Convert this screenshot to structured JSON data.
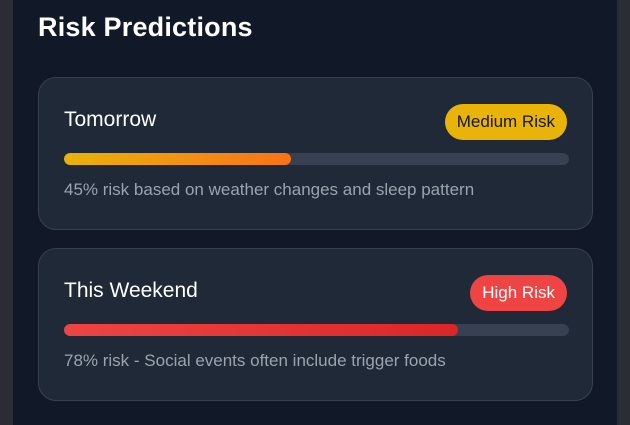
{
  "section": {
    "title": "Risk Predictions"
  },
  "predictions": [
    {
      "label": "Tomorrow",
      "badge": "Medium Risk",
      "risk_percent": 45,
      "description": "45% risk based on weather changes and sleep pattern",
      "badge_color": "#eab308",
      "bar_colors": [
        "#eab308",
        "#f97316"
      ]
    },
    {
      "label": "This Weekend",
      "badge": "High Risk",
      "risk_percent": 78,
      "description": "78% risk - Social events often include trigger foods",
      "badge_color": "#ef4444",
      "bar_colors": [
        "#ef4444",
        "#dc2626"
      ]
    }
  ]
}
